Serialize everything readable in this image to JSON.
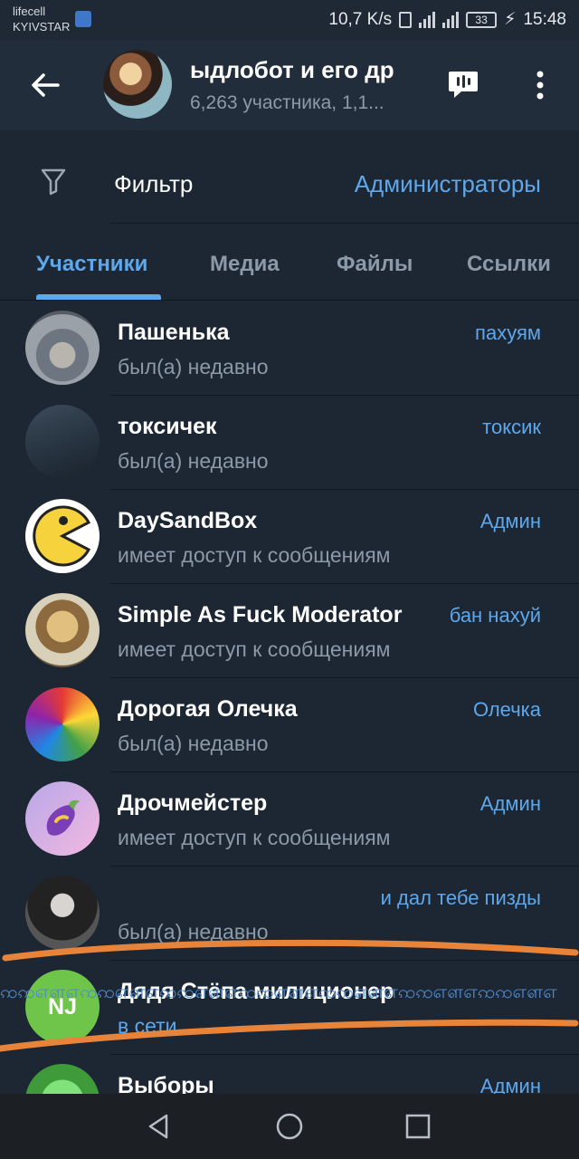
{
  "status_bar": {
    "carrier_line1": "lifecell",
    "carrier_line2": "KYIVSTAR",
    "net_speed": "10,7 K/s",
    "battery": "33",
    "time": "15:48"
  },
  "header": {
    "title": "ыдлобот и его др",
    "subtitle": "6,263 участника, 1,1..."
  },
  "filter": {
    "label": "Фильтр",
    "value": "Администраторы"
  },
  "tabs": [
    {
      "label": "Участники",
      "active": true
    },
    {
      "label": "Медиа",
      "active": false
    },
    {
      "label": "Файлы",
      "active": false
    },
    {
      "label": "Ссылки",
      "active": false
    }
  ],
  "members": [
    {
      "name": "Пашенька",
      "status": "был(а) недавно",
      "role": "пахуям"
    },
    {
      "name": "токсичек",
      "status": "был(а) недавно",
      "role": "токсик"
    },
    {
      "name": "DaySandBox",
      "status": "имеет доступ к сообщениям",
      "role": "Админ"
    },
    {
      "name": "Simple As Fuck Moderator",
      "status": "имеет доступ к сообщениям",
      "role": "бан нахуй"
    },
    {
      "name": "Дорогая Олечка",
      "status": "был(а) недавно",
      "role": "Олечка"
    },
    {
      "name": "Дрочмейстер",
      "status": "имеет доступ к сообщениям",
      "role": "Админ"
    },
    {
      "name": "",
      "status": "был(а) недавно",
      "role": "и дал тебе пизды"
    },
    {
      "name": "Дядя Стёпа милиционер",
      "status": "в сети",
      "role": "",
      "initials": "NJ"
    },
    {
      "name": "Выборы",
      "status": "",
      "role": "Админ"
    }
  ],
  "overlay_text": "ꩡꩡஎளஎꩡꩡஎளஎꩡꩡஎளஎꩡꩡஎளஎꩡꩡஎளஎꩡꩡஎளஎꩡꩡஎளஎ",
  "colors": {
    "accent": "#5ea7ea",
    "background": "#1d2733",
    "header": "#212d3b",
    "annotation_stroke": "#e8843a"
  },
  "icons": {
    "back": "arrow-left-icon",
    "voice_chat": "voice-chat-icon",
    "menu": "more-vertical-icon",
    "filter": "filter-icon",
    "nav_back": "triangle-back-icon",
    "nav_home": "circle-home-icon",
    "nav_recents": "square-recents-icon"
  }
}
